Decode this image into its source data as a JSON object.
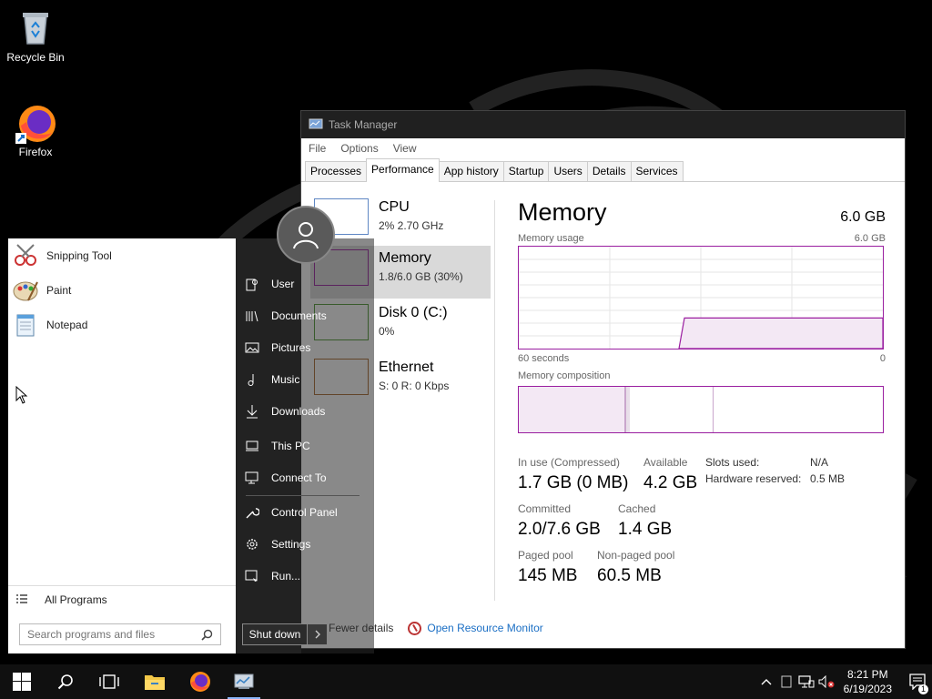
{
  "desktop": {
    "icons": [
      {
        "label": "Recycle Bin",
        "icon": "recycle-bin-icon"
      },
      {
        "label": "Firefox",
        "icon": "firefox-icon"
      }
    ]
  },
  "task_manager": {
    "title": "Task Manager",
    "menu": [
      "File",
      "Options",
      "View"
    ],
    "tabs": [
      "Processes",
      "Performance",
      "App history",
      "Startup",
      "Users",
      "Details",
      "Services"
    ],
    "active_tab": "Performance",
    "resources": [
      {
        "name": "CPU",
        "value": "2% 2.70 GHz"
      },
      {
        "name": "Memory",
        "value": "1.8/6.0 GB (30%)"
      },
      {
        "name": "Disk 0 (C:)",
        "value": "0%"
      },
      {
        "name": "Ethernet",
        "value": "S: 0 R: 0 Kbps"
      }
    ],
    "selected_resource": "Memory",
    "detail": {
      "title": "Memory",
      "total": "6.0 GB",
      "usage_label": "Memory usage",
      "usage_max": "6.0 GB",
      "time_left": "60 seconds",
      "time_right": "0",
      "composition_label": "Memory composition",
      "usage_fraction": 0.3,
      "stats": {
        "in_use_label": "In use (Compressed)",
        "in_use_value": "1.7 GB (0 MB)",
        "available_label": "Available",
        "available_value": "4.2 GB",
        "committed_label": "Committed",
        "committed_value": "2.0/7.6 GB",
        "cached_label": "Cached",
        "cached_value": "1.4 GB",
        "paged_label": "Paged pool",
        "paged_value": "145 MB",
        "nonpaged_label": "Non-paged pool",
        "nonpaged_value": "60.5 MB"
      },
      "side": {
        "slots_label": "Slots used:",
        "slots_value": "N/A",
        "hw_label": "Hardware reserved:",
        "hw_value": "0.5 MB"
      }
    },
    "footer": {
      "fewer_details": "Fewer details",
      "resource_monitor": "Open Resource Monitor"
    }
  },
  "start_menu": {
    "programs": [
      "Snipping Tool",
      "Paint",
      "Notepad"
    ],
    "all_programs": "All Programs",
    "search_placeholder": "Search programs and files",
    "places": [
      "User",
      "Documents",
      "Pictures",
      "Music",
      "Downloads",
      "This PC",
      "Connect To",
      "Control Panel",
      "Settings",
      "Run..."
    ],
    "shutdown": "Shut down"
  },
  "taskbar": {
    "time": "8:21 PM",
    "date": "6/19/2023",
    "notification_count": "1"
  },
  "colors": {
    "memory_accent": "#9a1ea0",
    "link": "#1a6ec4",
    "taskbar": "#101010"
  }
}
